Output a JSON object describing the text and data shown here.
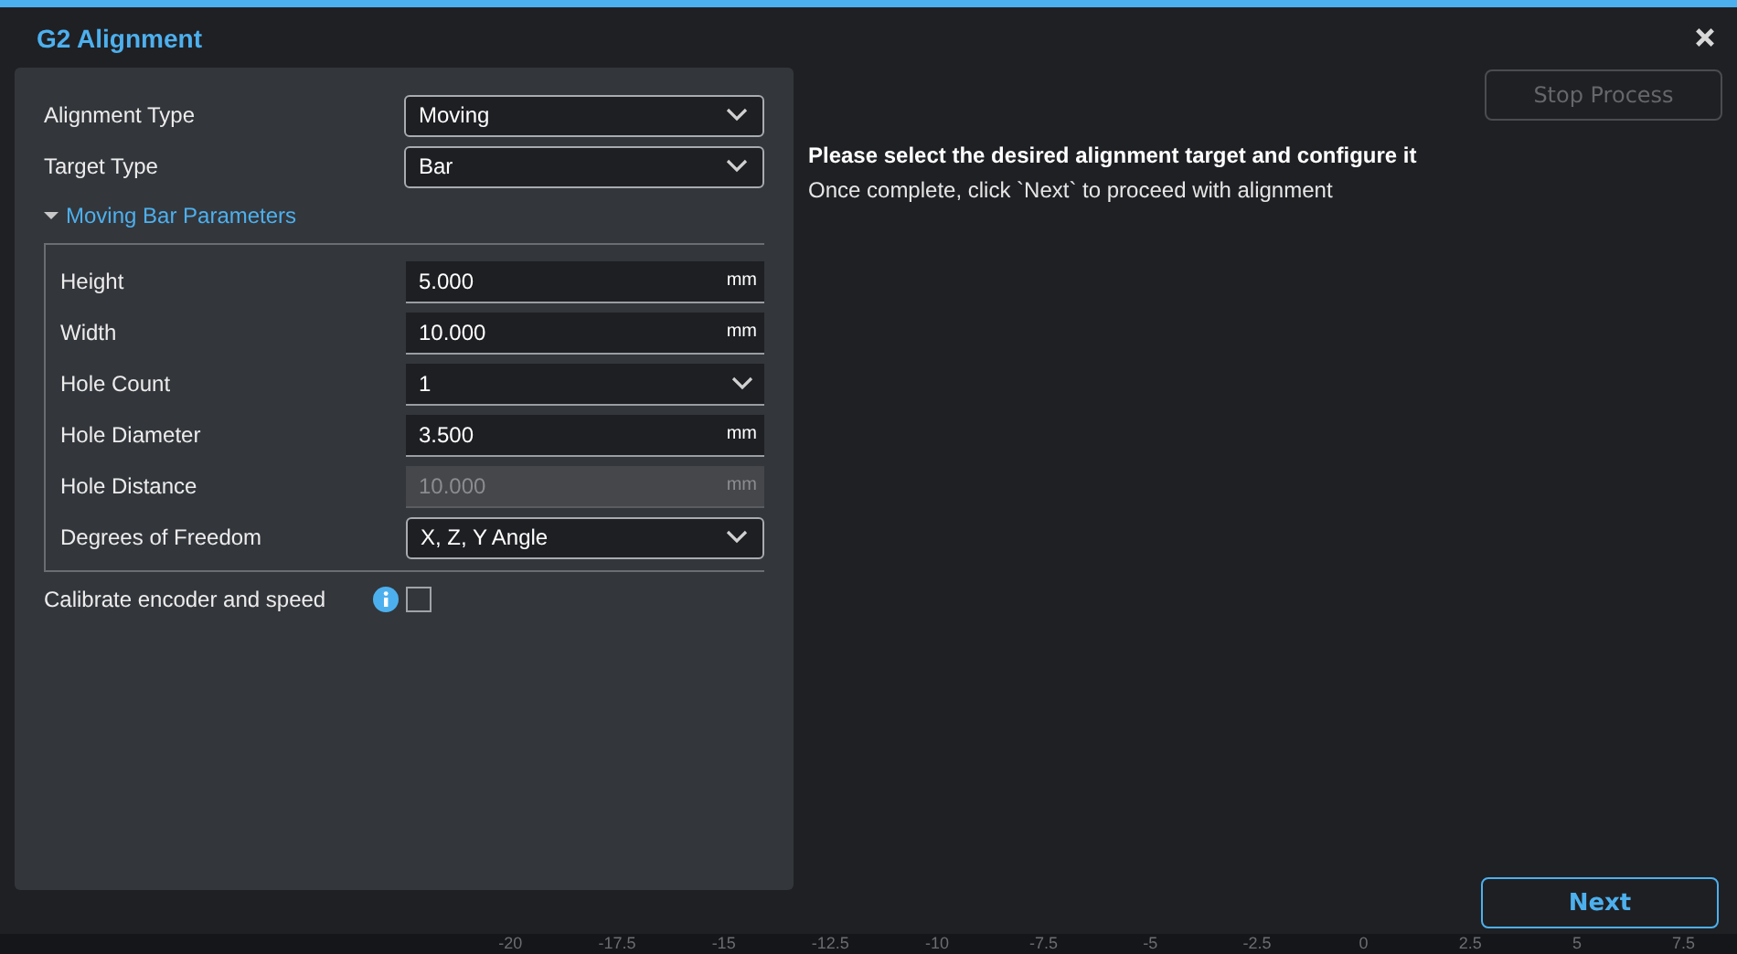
{
  "dialog": {
    "title": "G2 Alignment"
  },
  "form": {
    "fields": [
      {
        "kind": "select",
        "label": "Alignment Type",
        "value": "Moving"
      },
      {
        "kind": "select",
        "label": "Target Type",
        "value": "Bar"
      }
    ],
    "section": {
      "title": "Moving Bar Parameters",
      "expanded": true,
      "fields": [
        {
          "kind": "number",
          "label": "Height",
          "value": "5.000",
          "unit": "mm",
          "disabled": false
        },
        {
          "kind": "number",
          "label": "Width",
          "value": "10.000",
          "unit": "mm",
          "disabled": false
        },
        {
          "kind": "dropdown",
          "label": "Hole Count",
          "value": "1"
        },
        {
          "kind": "number",
          "label": "Hole Diameter",
          "value": "3.500",
          "unit": "mm",
          "disabled": false
        },
        {
          "kind": "number",
          "label": "Hole Distance",
          "value": "10.000",
          "unit": "mm",
          "disabled": true
        },
        {
          "kind": "select",
          "label": "Degrees of Freedom",
          "value": "X, Z, Y Angle"
        }
      ]
    },
    "calibrate": {
      "label": "Calibrate encoder and speed",
      "checked": false
    }
  },
  "stop_button": {
    "label": "Stop Process",
    "disabled": true
  },
  "instructions": {
    "heading": "Please select the desired alignment target and configure it",
    "note": "Once complete, click `Next` to proceed with alignment"
  },
  "next_button": {
    "label": "Next"
  },
  "background_axis": {
    "tick_labels": [
      "-20",
      "-17.5",
      "-15",
      "-12.5",
      "-10",
      "-7.5",
      "-5",
      "-2.5",
      "0",
      "2.5",
      "5",
      "7.5"
    ]
  }
}
